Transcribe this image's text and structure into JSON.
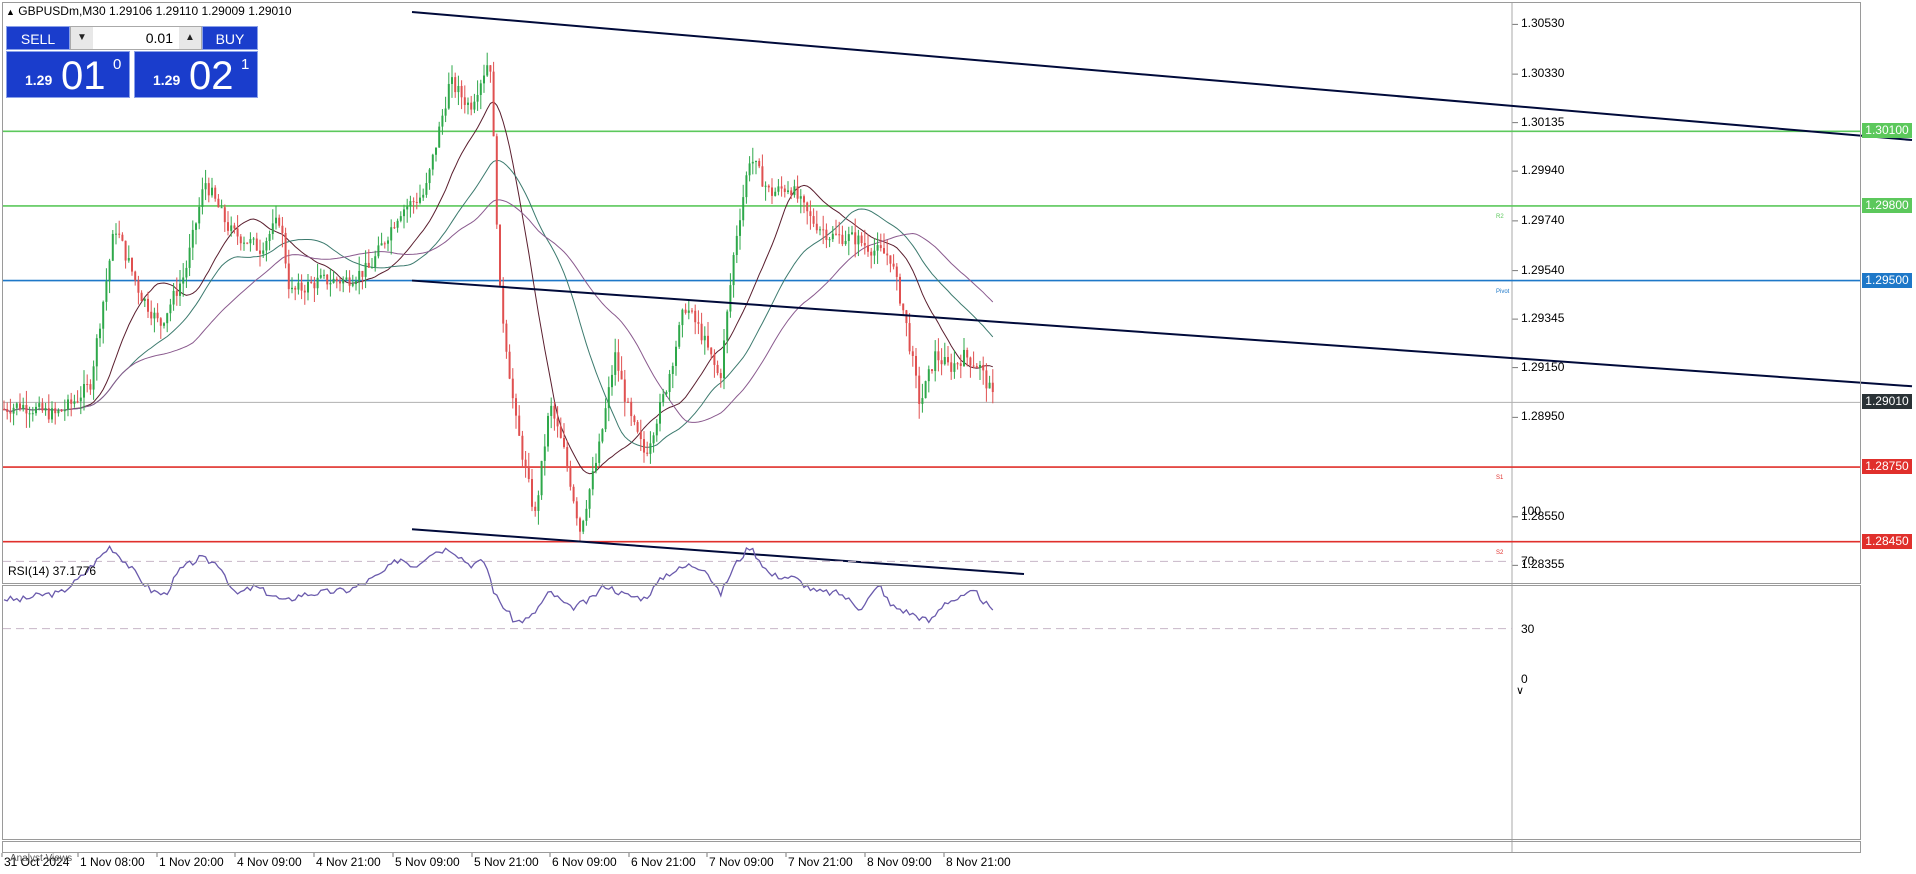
{
  "header": {
    "symbol_line": "GBPUSDm,M30  1.29106 1.29110 1.29009 1.29010",
    "collapse_icon": "triangle-up-icon"
  },
  "trade_panel": {
    "sell_label": "SELL",
    "buy_label": "BUY",
    "lot": "0.01",
    "lot_down_icon": "arrow-down-icon",
    "lot_up_icon": "arrow-up-icon",
    "sell_price": {
      "small": "1.29",
      "big": "01",
      "sup": "0"
    },
    "buy_price": {
      "small": "1.29",
      "big": "02",
      "sup": "1"
    }
  },
  "price_axis": [
    {
      "label": "1.30530",
      "value": 1.3053
    },
    {
      "label": "1.30330",
      "value": 1.3033
    },
    {
      "label": "1.30135",
      "value": 1.30135
    },
    {
      "label": "1.29940",
      "value": 1.2994
    },
    {
      "label": "1.29740",
      "value": 1.2974
    },
    {
      "label": "1.29540",
      "value": 1.2954
    },
    {
      "label": "1.29345",
      "value": 1.29345
    },
    {
      "label": "1.29150",
      "value": 1.2915
    },
    {
      "label": "1.28950",
      "value": 1.2895
    },
    {
      "label": "1.28550",
      "value": 1.2855
    },
    {
      "label": "1.28355",
      "value": 1.28355
    }
  ],
  "levels": [
    {
      "name": "r-level-1",
      "price": 1.301,
      "label": "1.30100",
      "color": "#5cc85c",
      "side": ""
    },
    {
      "name": "r2-level",
      "price": 1.298,
      "label": "1.29800",
      "color": "#5cc85c",
      "side": "R2"
    },
    {
      "name": "pivot-level",
      "price": 1.295,
      "label": "1.29500",
      "color": "#1e78c8",
      "side": "Pivot"
    },
    {
      "name": "s1-level",
      "price": 1.2875,
      "label": "1.28750",
      "color": "#e0302c",
      "side": "S1"
    },
    {
      "name": "s2-level",
      "price": 1.2845,
      "label": "1.28450",
      "color": "#e0302c",
      "side": "S2"
    }
  ],
  "current_price": {
    "price": 1.2901,
    "label": "1.29010",
    "color": "#2a3236"
  },
  "rsi": {
    "title": "RSI(14) 37.1776",
    "axis": [
      {
        "label": "100",
        "value": 100
      },
      {
        "label": "70",
        "value": 70
      },
      {
        "label": "30",
        "value": 30
      },
      {
        "label": "0",
        "value": 0
      }
    ],
    "line_color": "#6a5aac",
    "level_color": "#c8b6c8"
  },
  "dates": [
    "31 Oct 2024",
    "1 Nov 08:00",
    "1 Nov 20:00",
    "4 Nov 09:00",
    "4 Nov 21:00",
    "5 Nov 09:00",
    "5 Nov 21:00",
    "6 Nov 09:00",
    "6 Nov 21:00",
    "7 Nov 09:00",
    "7 Nov 21:00",
    "8 Nov 09:00",
    "8 Nov 21:00"
  ],
  "bottom_label": "Analyst Views",
  "colors": {
    "bull": "#2ea84a",
    "bear": "#e05050",
    "ma_dark": "#5a1e2e",
    "ma_green": "#3c7a6e",
    "ma_purple": "#8a5a8e",
    "channel": "#000a3a"
  },
  "chart_data": {
    "type": "candlestick",
    "symbol": "GBPUSDm",
    "timeframe": "M30",
    "ohlc_last": {
      "open": 1.29106,
      "high": 1.2911,
      "low": 1.29009,
      "close": 1.2901
    },
    "close_path": [
      [
        0,
        1.2898
      ],
      [
        20,
        1.29
      ],
      [
        55,
        1.2896
      ],
      [
        70,
        1.29
      ],
      [
        90,
        1.2908
      ],
      [
        115,
        1.2972
      ],
      [
        140,
        1.2945
      ],
      [
        160,
        1.2932
      ],
      [
        185,
        1.2953
      ],
      [
        205,
        1.299
      ],
      [
        230,
        1.297
      ],
      [
        260,
        1.2963
      ],
      [
        280,
        1.2975
      ],
      [
        290,
        1.2945
      ],
      [
        320,
        1.295
      ],
      [
        345,
        1.295
      ],
      [
        370,
        1.2955
      ],
      [
        400,
        1.2978
      ],
      [
        425,
        1.2985
      ],
      [
        450,
        1.303
      ],
      [
        470,
        1.302
      ],
      [
        490,
        1.304
      ],
      [
        500,
        1.2945
      ],
      [
        515,
        1.2895
      ],
      [
        535,
        1.2855
      ],
      [
        550,
        1.29
      ],
      [
        565,
        1.288
      ],
      [
        580,
        1.285
      ],
      [
        598,
        1.288
      ],
      [
        615,
        1.292
      ],
      [
        630,
        1.2895
      ],
      [
        645,
        1.288
      ],
      [
        665,
        1.2905
      ],
      [
        685,
        1.294
      ],
      [
        700,
        1.293
      ],
      [
        720,
        1.291
      ],
      [
        735,
        1.2965
      ],
      [
        750,
        1.3
      ],
      [
        770,
        1.2985
      ],
      [
        790,
        1.2988
      ],
      [
        810,
        1.2975
      ],
      [
        830,
        1.2968
      ],
      [
        855,
        1.2967
      ],
      [
        875,
        1.2962
      ],
      [
        890,
        1.296
      ],
      [
        905,
        1.2935
      ],
      [
        920,
        1.29
      ],
      [
        935,
        1.292
      ],
      [
        950,
        1.2915
      ],
      [
        965,
        1.292
      ],
      [
        980,
        1.2915
      ],
      [
        995,
        1.2901
      ]
    ],
    "channel_lines": [
      {
        "from": [
          412,
          1.3058
        ],
        "to": [
          1912,
          1.30065
        ]
      },
      {
        "from": [
          412,
          1.295
        ],
        "to": [
          1912,
          1.29075
        ]
      },
      {
        "from": [
          412,
          1.285
        ],
        "to": [
          1024,
          1.2832
        ]
      }
    ],
    "rsi_path": [
      [
        0,
        48
      ],
      [
        20,
        47
      ],
      [
        40,
        50
      ],
      [
        60,
        51
      ],
      [
        80,
        60
      ],
      [
        110,
        79
      ],
      [
        125,
        70
      ],
      [
        150,
        53
      ],
      [
        165,
        50
      ],
      [
        180,
        65
      ],
      [
        200,
        72
      ],
      [
        220,
        68
      ],
      [
        235,
        50
      ],
      [
        255,
        55
      ],
      [
        285,
        46
      ],
      [
        300,
        50
      ],
      [
        330,
        52
      ],
      [
        350,
        53
      ],
      [
        380,
        62
      ],
      [
        400,
        72
      ],
      [
        415,
        67
      ],
      [
        430,
        75
      ],
      [
        450,
        78
      ],
      [
        470,
        68
      ],
      [
        485,
        70
      ],
      [
        495,
        50
      ],
      [
        515,
        34
      ],
      [
        530,
        36
      ],
      [
        550,
        52
      ],
      [
        570,
        42
      ],
      [
        590,
        47
      ],
      [
        605,
        56
      ],
      [
        625,
        50
      ],
      [
        645,
        48
      ],
      [
        665,
        62
      ],
      [
        690,
        68
      ],
      [
        705,
        66
      ],
      [
        720,
        50
      ],
      [
        735,
        68
      ],
      [
        750,
        79
      ],
      [
        770,
        62
      ],
      [
        795,
        60
      ],
      [
        815,
        52
      ],
      [
        840,
        51
      ],
      [
        860,
        42
      ],
      [
        880,
        56
      ],
      [
        890,
        44
      ],
      [
        915,
        38
      ],
      [
        930,
        34
      ],
      [
        945,
        46
      ],
      [
        960,
        48
      ],
      [
        975,
        52
      ],
      [
        990,
        42
      ],
      [
        995,
        37
      ]
    ],
    "rsi_levels": [
      30,
      70
    ],
    "price_range": [
      1.2828,
      1.3062
    ],
    "rsi_range": [
      0,
      100
    ]
  }
}
